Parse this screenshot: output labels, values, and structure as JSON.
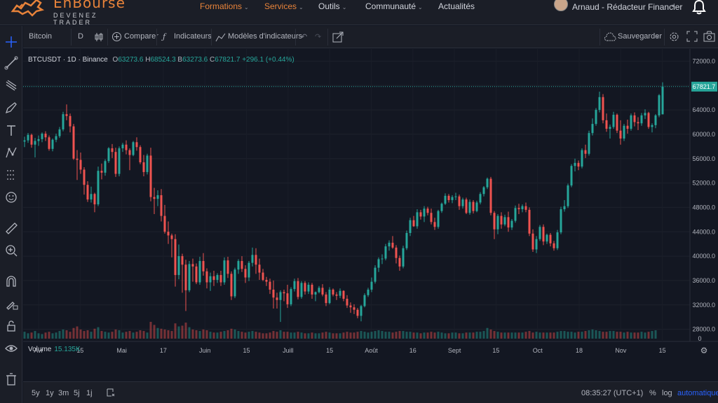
{
  "brand": {
    "name": "EnBourse",
    "tagline": "DEVENEZ TRADER"
  },
  "nav": [
    {
      "label": "Formations",
      "dropdown": true,
      "active": true
    },
    {
      "label": "Services",
      "dropdown": true,
      "active": true
    },
    {
      "label": "Outils",
      "dropdown": true,
      "active": false
    },
    {
      "label": "Communauté",
      "dropdown": true,
      "active": false
    },
    {
      "label": "Actualités",
      "dropdown": false,
      "active": false
    }
  ],
  "user": {
    "name": "Arnaud - Rédacteur Financier"
  },
  "toolbar": {
    "symbol": "Bitcoin",
    "interval": "D",
    "compare": "Comparer",
    "indicators": "Indicateurs",
    "templates": "Modèles d'indicateurs",
    "save": "Sauvegarder"
  },
  "legend": {
    "symbol": "BTCUSDT · 1D · Binance",
    "o_label": "O",
    "o": "63273.6",
    "h_label": "H",
    "h": "68524.3",
    "b_label": "B",
    "b": "63273.6",
    "c_label": "C",
    "c": "67821.7",
    "change": "+296.1 (+0.44%)"
  },
  "volume": {
    "label": "Volume",
    "value": "15.135K"
  },
  "bottom": {
    "ranges": [
      "5y",
      "1y",
      "3m",
      "5j",
      "1j"
    ],
    "time": "08:35:27 (UTC+1)",
    "percent": "%",
    "log": "log",
    "auto": "automatique"
  },
  "colors": {
    "up": "#26a69a",
    "down": "#ef5350",
    "accent": "#e8833a",
    "bg": "#131722",
    "panel": "#1b1e27"
  },
  "chart_data": {
    "type": "candlestick",
    "symbol": "BTCUSDT",
    "interval": "1D",
    "exchange": "Binance",
    "y_ticks": [
      28000,
      32000,
      36000,
      40000,
      44000,
      48000,
      52000,
      56000,
      60000,
      64000,
      68000,
      72000
    ],
    "x_ticks": [
      "Avr",
      "15",
      "Mai",
      "17",
      "Juin",
      "15",
      "Juill",
      "15",
      "Août",
      "16",
      "Sept",
      "15",
      "Oct",
      "18",
      "Nov",
      "15"
    ],
    "last_price": "67821.7",
    "volume_axis_label": "0",
    "candles": [
      [
        58800,
        59600,
        57900,
        59000
      ],
      [
        59000,
        60200,
        58600,
        59900
      ],
      [
        59900,
        60100,
        57800,
        58300
      ],
      [
        58300,
        59400,
        56200,
        58900
      ],
      [
        58900,
        59800,
        58100,
        59200
      ],
      [
        59200,
        60300,
        58700,
        60100
      ],
      [
        60100,
        60500,
        58900,
        59500
      ],
      [
        59500,
        59800,
        57300,
        57600
      ],
      [
        57600,
        59300,
        57200,
        59100
      ],
      [
        59100,
        60100,
        58700,
        59700
      ],
      [
        59700,
        61200,
        59400,
        60800
      ],
      [
        60800,
        63700,
        60500,
        63300
      ],
      [
        63300,
        64900,
        62300,
        63000
      ],
      [
        63000,
        63400,
        60300,
        61300
      ],
      [
        61300,
        61700,
        55800,
        56000
      ],
      [
        56000,
        57400,
        52500,
        55800
      ],
      [
        55800,
        57000,
        53500,
        54200
      ],
      [
        54200,
        54600,
        50100,
        51700
      ],
      [
        51700,
        52300,
        48900,
        49300
      ],
      [
        49300,
        51400,
        48800,
        50200
      ],
      [
        50200,
        50400,
        47200,
        48500
      ],
      [
        48500,
        54700,
        48200,
        54000
      ],
      [
        54000,
        55200,
        52600,
        53700
      ],
      [
        53700,
        55900,
        53200,
        55600
      ],
      [
        55600,
        57900,
        55300,
        57700
      ],
      [
        57700,
        58400,
        56100,
        57100
      ],
      [
        57100,
        57800,
        53000,
        53500
      ],
      [
        53500,
        58000,
        53100,
        57700
      ],
      [
        57700,
        58600,
        57100,
        58300
      ],
      [
        58300,
        59000,
        56700,
        57400
      ],
      [
        57400,
        57700,
        54100,
        56600
      ],
      [
        56600,
        58900,
        56400,
        58700
      ],
      [
        58700,
        59500,
        57300,
        57900
      ],
      [
        57900,
        58200,
        55100,
        55400
      ],
      [
        55400,
        56600,
        53100,
        53800
      ],
      [
        53800,
        56800,
        53400,
        56500
      ],
      [
        56500,
        57800,
        49000,
        49700
      ],
      [
        49700,
        51200,
        46900,
        49400
      ],
      [
        49400,
        50800,
        48200,
        50000
      ],
      [
        50000,
        51000,
        45700,
        46600
      ],
      [
        46600,
        48400,
        43700,
        44000
      ],
      [
        44000,
        45700,
        42000,
        43400
      ],
      [
        43400,
        43700,
        39800,
        42800
      ],
      [
        42800,
        43600,
        35000,
        36900
      ],
      [
        36900,
        41900,
        36200,
        40000
      ],
      [
        40000,
        40400,
        34000,
        38600
      ],
      [
        38600,
        39400,
        31000,
        34400
      ],
      [
        34400,
        39200,
        34100,
        38700
      ],
      [
        38700,
        39600,
        35800,
        38300
      ],
      [
        38300,
        38800,
        35400,
        35700
      ],
      [
        35700,
        39900,
        35300,
        39200
      ],
      [
        39200,
        40500,
        36800,
        37500
      ],
      [
        37500,
        38000,
        34700,
        35700
      ],
      [
        35700,
        37300,
        34300,
        36700
      ],
      [
        36700,
        37600,
        35100,
        36100
      ],
      [
        36100,
        37200,
        35600,
        36900
      ],
      [
        36900,
        37600,
        35100,
        35700
      ],
      [
        35700,
        39800,
        35300,
        39300
      ],
      [
        39300,
        39900,
        36400,
        37100
      ],
      [
        37100,
        37500,
        32800,
        33400
      ],
      [
        33400,
        38100,
        33100,
        37800
      ],
      [
        37800,
        39500,
        37100,
        39200
      ],
      [
        39200,
        40000,
        37400,
        37900
      ],
      [
        37900,
        38500,
        35600,
        36500
      ],
      [
        36500,
        39200,
        35900,
        38900
      ],
      [
        38900,
        41400,
        38300,
        40200
      ],
      [
        40200,
        41300,
        37100,
        38600
      ],
      [
        38600,
        39600,
        36100,
        37300
      ],
      [
        37300,
        37900,
        35900,
        36100
      ],
      [
        36100,
        36600,
        35100,
        35800
      ],
      [
        35800,
        36300,
        33800,
        34500
      ],
      [
        34500,
        36000,
        31400,
        33200
      ],
      [
        33200,
        34000,
        31400,
        32800
      ],
      [
        32800,
        34400,
        29200,
        34100
      ],
      [
        34100,
        34500,
        32600,
        33900
      ],
      [
        33900,
        35300,
        31500,
        32100
      ],
      [
        32100,
        34900,
        31800,
        34600
      ],
      [
        34600,
        36300,
        34200,
        35900
      ],
      [
        35900,
        36400,
        32900,
        33300
      ],
      [
        33300,
        35900,
        33000,
        35600
      ],
      [
        35600,
        35900,
        33700,
        34200
      ],
      [
        34200,
        35700,
        33800,
        35300
      ],
      [
        35300,
        35600,
        33000,
        33700
      ],
      [
        33700,
        34200,
        32600,
        34100
      ],
      [
        34100,
        35100,
        33900,
        34800
      ],
      [
        34800,
        35400,
        33400,
        33700
      ],
      [
        33700,
        34100,
        31800,
        32300
      ],
      [
        32300,
        34900,
        32100,
        34500
      ],
      [
        34500,
        34700,
        33400,
        33700
      ],
      [
        33700,
        34100,
        32800,
        33500
      ],
      [
        33500,
        34700,
        33100,
        34300
      ],
      [
        34300,
        34400,
        32600,
        33000
      ],
      [
        33000,
        33600,
        31500,
        31900
      ],
      [
        31900,
        32400,
        30700,
        31600
      ],
      [
        31600,
        32100,
        30500,
        31200
      ],
      [
        31200,
        31500,
        29800,
        30200
      ],
      [
        30200,
        32000,
        29300,
        31800
      ],
      [
        31800,
        33900,
        31600,
        33600
      ],
      [
        33600,
        34800,
        33300,
        34500
      ],
      [
        34500,
        36500,
        34100,
        35800
      ],
      [
        35800,
        38500,
        35500,
        38100
      ],
      [
        38100,
        39800,
        37400,
        39500
      ],
      [
        39500,
        40300,
        38700,
        39600
      ],
      [
        39600,
        42000,
        39300,
        41600
      ],
      [
        41600,
        42600,
        40900,
        42200
      ],
      [
        42200,
        43300,
        41200,
        41400
      ],
      [
        41400,
        41800,
        38800,
        39700
      ],
      [
        39700,
        40100,
        37600,
        38300
      ],
      [
        38300,
        41700,
        38000,
        41300
      ],
      [
        41300,
        44200,
        41000,
        43800
      ],
      [
        43800,
        46300,
        43300,
        45900
      ],
      [
        45900,
        46600,
        44800,
        44900
      ],
      [
        44900,
        47700,
        44500,
        47200
      ],
      [
        47200,
        47600,
        46000,
        46500
      ],
      [
        46500,
        48200,
        45600,
        47800
      ],
      [
        47800,
        48100,
        46700,
        47100
      ],
      [
        47100,
        47800,
        45200,
        45600
      ],
      [
        45600,
        46300,
        44300,
        44800
      ],
      [
        44800,
        47600,
        44500,
        47400
      ],
      [
        47400,
        48800,
        47100,
        48600
      ],
      [
        48600,
        50300,
        48400,
        49900
      ],
      [
        49900,
        50200,
        48800,
        49200
      ],
      [
        49200,
        50000,
        48700,
        49700
      ],
      [
        49700,
        50400,
        49200,
        49800
      ],
      [
        49800,
        50100,
        47600,
        48200
      ],
      [
        48200,
        49600,
        47800,
        49300
      ],
      [
        49300,
        49600,
        46900,
        47100
      ],
      [
        47100,
        49300,
        46800,
        48900
      ],
      [
        48900,
        49200,
        47000,
        47400
      ],
      [
        47400,
        49100,
        47200,
        48800
      ],
      [
        48800,
        50500,
        48500,
        50200
      ],
      [
        50200,
        51500,
        49800,
        51300
      ],
      [
        51300,
        52900,
        51000,
        52700
      ],
      [
        52700,
        53000,
        46700,
        47100
      ],
      [
        47100,
        47400,
        42800,
        44400
      ],
      [
        44400,
        46900,
        43600,
        46600
      ],
      [
        46600,
        47200,
        44500,
        45200
      ],
      [
        45200,
        46800,
        44900,
        46400
      ],
      [
        46400,
        47300,
        44000,
        44700
      ],
      [
        44700,
        46100,
        44300,
        45800
      ],
      [
        45800,
        48300,
        45500,
        47900
      ],
      [
        47900,
        48600,
        46900,
        47700
      ],
      [
        47700,
        48500,
        47200,
        48200
      ],
      [
        48200,
        48800,
        47200,
        47600
      ],
      [
        47600,
        48000,
        43300,
        43700
      ],
      [
        43700,
        44400,
        40700,
        41100
      ],
      [
        41100,
        43300,
        40500,
        42800
      ],
      [
        42800,
        45100,
        42500,
        44800
      ],
      [
        44800,
        45200,
        41800,
        42400
      ],
      [
        42400,
        43700,
        42000,
        43500
      ],
      [
        43500,
        43800,
        41600,
        42100
      ],
      [
        42100,
        42500,
        40900,
        41300
      ],
      [
        41300,
        44300,
        41000,
        43900
      ],
      [
        43900,
        48100,
        43600,
        47700
      ],
      [
        47700,
        49200,
        47300,
        48200
      ],
      [
        48200,
        51900,
        47900,
        51600
      ],
      [
        51600,
        55100,
        51300,
        54800
      ],
      [
        54800,
        56000,
        53900,
        55300
      ],
      [
        55300,
        55700,
        54100,
        54700
      ],
      [
        54700,
        57700,
        54400,
        57400
      ],
      [
        57400,
        58300,
        56100,
        56800
      ],
      [
        56800,
        60600,
        56500,
        60200
      ],
      [
        60200,
        62600,
        59800,
        61700
      ],
      [
        61700,
        64300,
        61400,
        64000
      ],
      [
        64000,
        67000,
        63600,
        66100
      ],
      [
        66100,
        66600,
        61800,
        62300
      ],
      [
        62300,
        63400,
        60400,
        60900
      ],
      [
        60900,
        61600,
        59300,
        61200
      ],
      [
        61200,
        63700,
        60900,
        63200
      ],
      [
        63200,
        63400,
        60200,
        60600
      ],
      [
        60600,
        62300,
        58300,
        59300
      ],
      [
        59300,
        61700,
        58900,
        61400
      ],
      [
        61400,
        62400,
        60100,
        60900
      ],
      [
        60900,
        63400,
        60600,
        63100
      ],
      [
        63100,
        63600,
        61300,
        62000
      ],
      [
        62000,
        62800,
        60700,
        61800
      ],
      [
        61800,
        63500,
        61400,
        63100
      ],
      [
        63100,
        64100,
        62500,
        63500
      ],
      [
        63500,
        63700,
        60900,
        61200
      ],
      [
        61200,
        61800,
        60300,
        61500
      ],
      [
        61500,
        63300,
        61000,
        63100
      ],
      [
        63100,
        66600,
        62800,
        66400
      ],
      [
        63273.6,
        68524.3,
        63273.6,
        67821.7
      ]
    ],
    "volumes": [
      9,
      7,
      8,
      10,
      7,
      6,
      8,
      9,
      7,
      8,
      10,
      12,
      11,
      9,
      14,
      16,
      12,
      10,
      11,
      9,
      13,
      15,
      10,
      9,
      8,
      9,
      12,
      11,
      8,
      9,
      10,
      8,
      9,
      11,
      10,
      8,
      22,
      18,
      14,
      13,
      12,
      11,
      10,
      20,
      16,
      17,
      21,
      15,
      12,
      11,
      10,
      12,
      11,
      9,
      8,
      8,
      9,
      10,
      11,
      13,
      12,
      10,
      9,
      8,
      9,
      10,
      9,
      8,
      7,
      7,
      8,
      10,
      9,
      11,
      9,
      9,
      8,
      8,
      9,
      8,
      7,
      7,
      8,
      7,
      7,
      8,
      9,
      8,
      7,
      7,
      7,
      8,
      9,
      8,
      8,
      9,
      10,
      9,
      8,
      9,
      10,
      11,
      10,
      9,
      9,
      8,
      9,
      10,
      10,
      9,
      9,
      8,
      8,
      7,
      8,
      8,
      9,
      8,
      9,
      8,
      7,
      7,
      8,
      8,
      7,
      7,
      8,
      8,
      8,
      9,
      9,
      10,
      14,
      12,
      10,
      9,
      8,
      8,
      8,
      8,
      8,
      8,
      8,
      9,
      10,
      8,
      9,
      8,
      8,
      8,
      8,
      8,
      9,
      10,
      10,
      9,
      9,
      8,
      9,
      9,
      10,
      11,
      12,
      11,
      10,
      9,
      9,
      10,
      10,
      9,
      9,
      8,
      9,
      8,
      8,
      8,
      9,
      8,
      9,
      10,
      11
    ]
  }
}
